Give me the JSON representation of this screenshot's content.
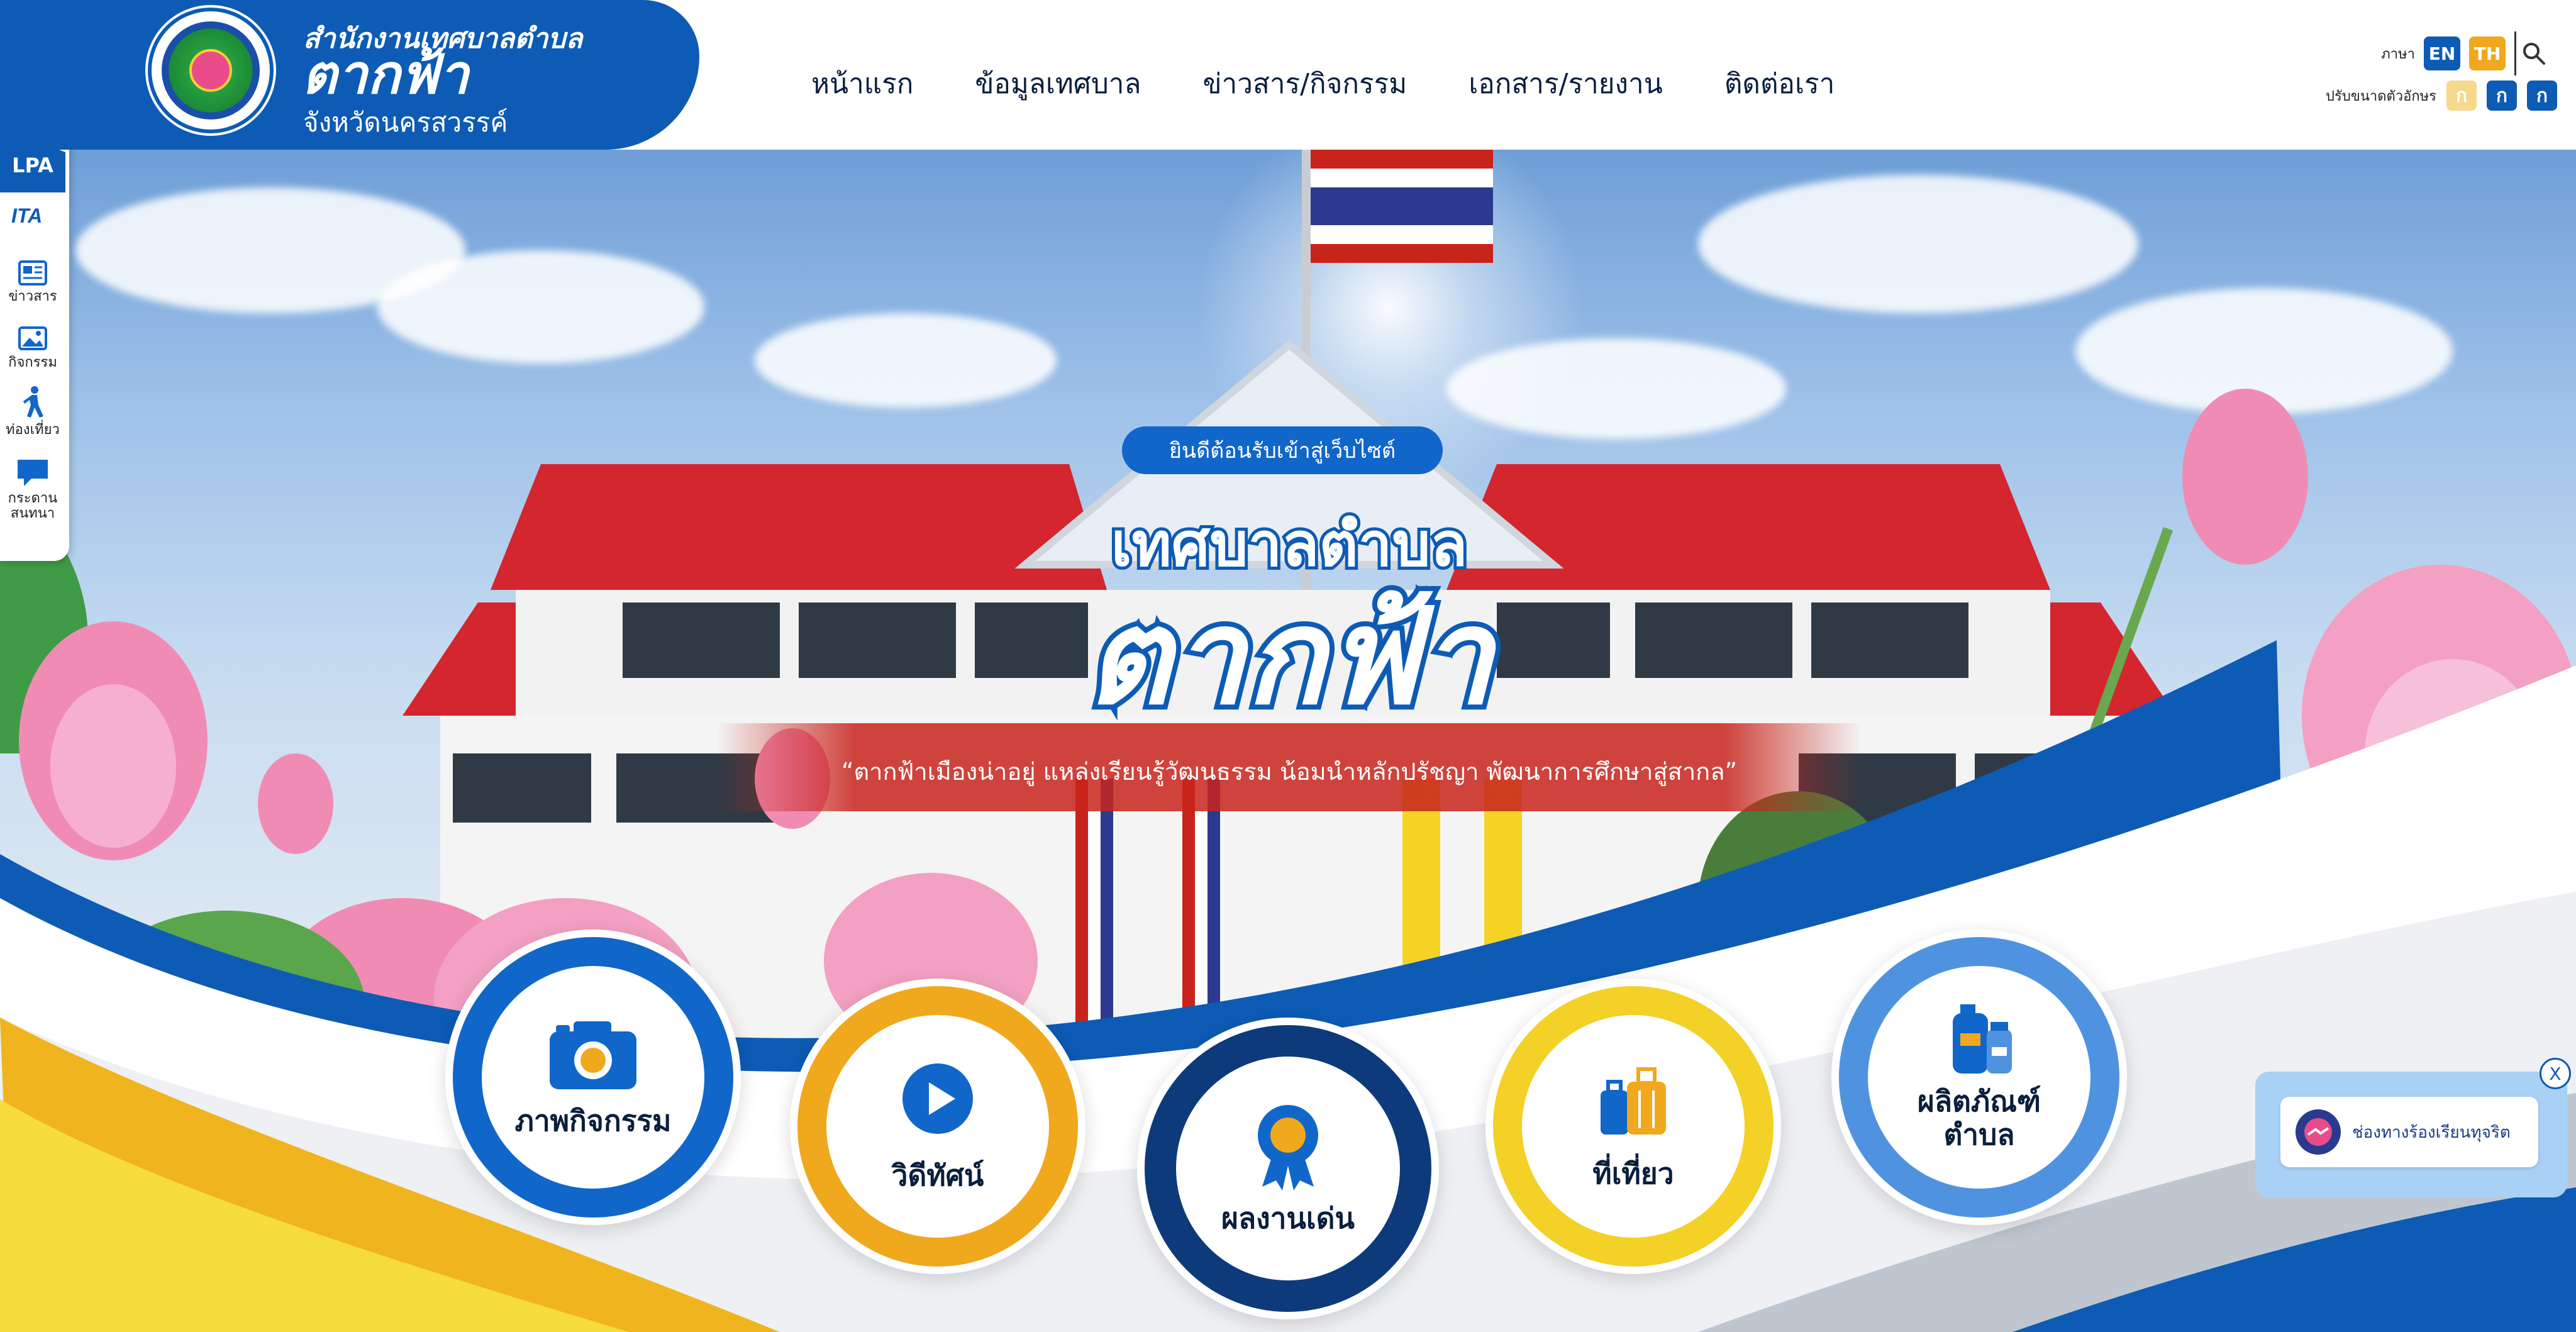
{
  "header": {
    "org_line1": "สำนักงานเทศบาลตำบล",
    "org_line2": "ตากฟ้า",
    "org_line3": "จังหวัดนครสวรรค์",
    "nav": [
      "หน้าแรก",
      "ข้อมูลเทศบาล",
      "ข่าวสาร/กิจกรรม",
      "เอกสาร/รายงาน",
      "ติดต่อเรา"
    ],
    "language_label": "ภาษา",
    "lang_en": "EN",
    "lang_th": "TH",
    "font_size_label": "ปรับขนาดตัวอักษร",
    "font_buttons": [
      "ก",
      "ก",
      "ก"
    ]
  },
  "sidebar": {
    "lpa": "LPA",
    "itа": "ITA",
    "items": [
      {
        "label": "ข่าวสาร",
        "icon": "newspaper-icon"
      },
      {
        "label": "กิจกรรม",
        "icon": "image-icon"
      },
      {
        "label": "ท่องเที่ยว",
        "icon": "walking-icon"
      },
      {
        "label": "กระดาน\nสนทนา",
        "icon": "chat-icon"
      }
    ]
  },
  "hero": {
    "welcome": "ยินดีต้อนรับเข้าสู่เว็บไซต์",
    "title_line1": "เทศบาลตำบล",
    "title_line2": "ตากฟ้า",
    "slogan": "“ตากฟ้าเมืองน่าอยู่ แหล่งเรียนรู้วัฒนธรรม น้อมนำหลักปรัชญา พัฒนาการศึกษาสู่สากล”"
  },
  "quick_menu": [
    {
      "label": "ภาพกิจกรรม",
      "icon": "camera-icon",
      "color": "#1166c9"
    },
    {
      "label": "วิดีทัศน์",
      "icon": "play-icon",
      "color": "#f0a81c"
    },
    {
      "label": "ผลงานเด่น",
      "icon": "award-icon",
      "color": "#0d3a7a"
    },
    {
      "label": "ที่เที่ยว",
      "icon": "luggage-icon",
      "color": "#f3d127"
    },
    {
      "label": "ผลิตภัณฑ์\nตำบล",
      "icon": "products-icon",
      "color": "#4f93e0"
    }
  ],
  "complaint_widget": {
    "label": "ช่องทางร้องเรียนทุจริต",
    "close": "X"
  },
  "colors": {
    "primary_blue": "#0d5bb5",
    "accent_orange": "#f0a81c",
    "accent_yellow": "#f3d127",
    "slogan_red": "#c8241c"
  }
}
